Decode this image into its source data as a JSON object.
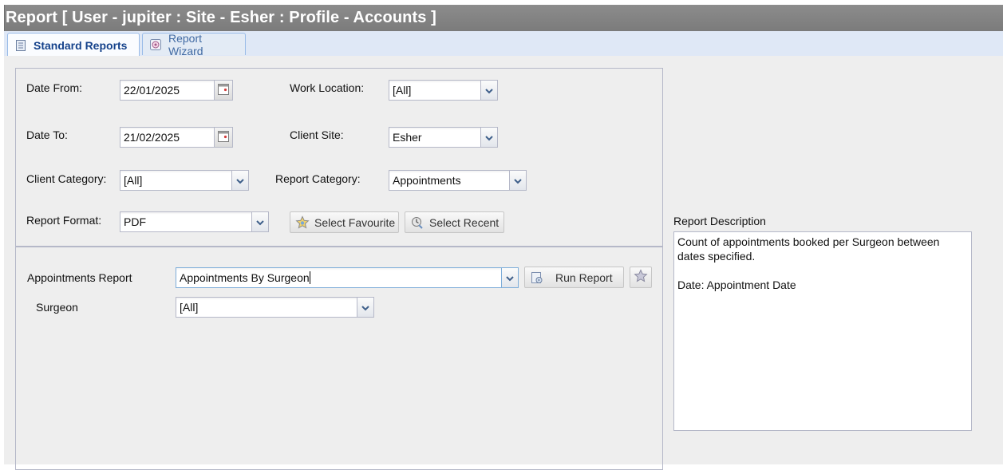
{
  "window": {
    "title": "Report [ User - jupiter : Site - Esher : Profile - Accounts ]"
  },
  "tabs": [
    {
      "label": "Standard Reports",
      "active": true,
      "icon": "report-list-icon"
    },
    {
      "label": "Report Wizard",
      "active": false,
      "icon": "wizard-icon"
    }
  ],
  "filters": {
    "date_from": {
      "label": "Date From:",
      "value": "22/01/2025"
    },
    "date_to": {
      "label": "Date To:",
      "value": "21/02/2025"
    },
    "work_location": {
      "label": "Work Location:",
      "value": "[All]"
    },
    "client_site": {
      "label": "Client Site:",
      "value": "Esher"
    },
    "client_category": {
      "label": "Client Category:",
      "value": "[All]"
    },
    "report_category": {
      "label": "Report Category:",
      "value": "Appointments"
    },
    "report_format": {
      "label": "Report Format:",
      "value": "PDF"
    },
    "select_favourite_label": "Select Favourite",
    "select_recent_label": "Select Recent"
  },
  "report": {
    "label": "Appointments Report",
    "value": "Appointments By Surgeon",
    "run_label": "Run Report",
    "surgeon_label": "Surgeon",
    "surgeon_value": "[All]"
  },
  "description": {
    "label": "Report Description",
    "text": "Count of appointments booked per Surgeon between dates specified.\n\nDate: Appointment Date"
  },
  "colors": {
    "title_bar": "#808080",
    "tab_strip": "#dfe8f6",
    "active_tab_text": "#15428b",
    "panel": "#eeeeee",
    "trigger_arrow": "#3e5f8a"
  }
}
